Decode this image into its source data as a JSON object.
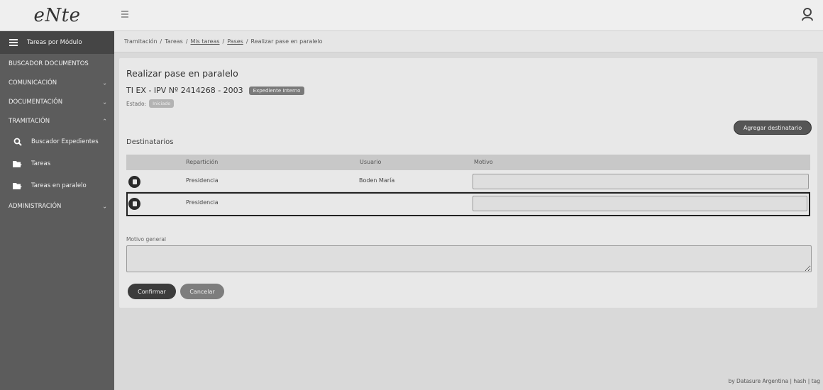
{
  "brand": {
    "logo_text": "eNte"
  },
  "sidebar": {
    "items": [
      {
        "label": "Tareas por Módulo",
        "icon": "list-icon"
      },
      {
        "label": "BUSCADOR DOCUMENTOS"
      },
      {
        "label": "COMUNICACIÓN",
        "chevron": "⌄"
      },
      {
        "label": "DOCUMENTACIÓN",
        "chevron": "⌄"
      },
      {
        "label": "TRAMITACIÓN",
        "chevron": "⌃"
      },
      {
        "label": "Buscador Expedientes",
        "icon": "search-icon"
      },
      {
        "label": "Tareas",
        "icon": "folder-arrow-icon"
      },
      {
        "label": "Tareas en paralelo",
        "icon": "folder-arrow-icon"
      },
      {
        "label": "ADMINISTRACIÓN",
        "chevron": "⌄"
      }
    ]
  },
  "breadcrumb": {
    "items": [
      "Tramitación",
      "Tareas",
      "Mis tareas",
      "Pases",
      "Realizar pase en paralelo"
    ]
  },
  "page": {
    "title": "Realizar pase en paralelo",
    "expediente": "TI EX - IPV Nº 2414268 - 2003",
    "expediente_badge": "Expediente Interno",
    "estado_label": "Estado:",
    "estado_value": "Iniciado"
  },
  "destinatarios": {
    "title": "Destinatarios",
    "add_button": "Agregar destinatario",
    "columns": {
      "reparticion": "Repartición",
      "usuario": "Usuario",
      "motivo": "Motivo"
    },
    "rows": [
      {
        "reparticion": "Presidencia",
        "usuario": "Boden María",
        "motivo": ""
      },
      {
        "reparticion": "Presidencia",
        "usuario": "",
        "motivo": ""
      }
    ]
  },
  "motivo_general": {
    "label": "Motivo general",
    "value": ""
  },
  "actions": {
    "confirm": "Confirmar",
    "cancel": "Cancelar"
  },
  "footer": {
    "text": "by Datasure Argentina | hash | tag"
  }
}
